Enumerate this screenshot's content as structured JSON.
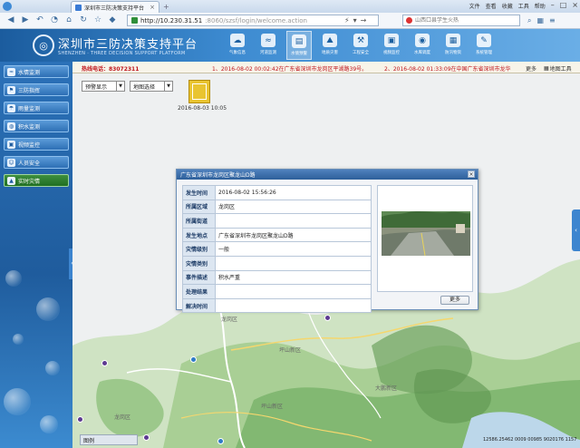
{
  "browser": {
    "tab_title": "深圳市三防决策支持平台",
    "url_host": "http://10.230.31.51",
    "url_path": ":8060/szsf/login/welcome.action",
    "search_placeholder": "山西口县学生火热",
    "window_menu": [
      "文件",
      "查看",
      "收藏",
      "工具",
      "帮助"
    ]
  },
  "app": {
    "title": "深圳市三防决策支持平台",
    "subtitle": "SHENZHEN · THREE DECISION SUPPORT PLATFORM",
    "modules": [
      {
        "label": "气象信息",
        "icon": "cloud-icon"
      },
      {
        "label": "河道监测",
        "icon": "water-icon"
      },
      {
        "label": "水情预警",
        "icon": "warning-icon",
        "active": true
      },
      {
        "label": "地质灾害",
        "icon": "mountain-icon"
      },
      {
        "label": "工程安全",
        "icon": "dam-icon"
      },
      {
        "label": "视频监控",
        "icon": "video-icon"
      },
      {
        "label": "水库调度",
        "icon": "reservoir-icon"
      },
      {
        "label": "防汛物资",
        "icon": "box-icon"
      },
      {
        "label": "系统管理",
        "icon": "tools-icon"
      }
    ]
  },
  "info": {
    "hotline": "热线电话：83072311",
    "ticker1": "1、2016-08-02 00:02:42在广东省深圳市龙岗区平湖路39号。",
    "ticker2": "2、2016-08-02 01:33:09在中国广东省深圳市龙华",
    "more": "更多",
    "full_map": "地图工具"
  },
  "sidebar": {
    "items": [
      {
        "label": "水情监测",
        "icon": "wave-icon"
      },
      {
        "label": "三防指挥",
        "icon": "command-icon"
      },
      {
        "label": "雨量监测",
        "icon": "rain-icon"
      },
      {
        "label": "积水监测",
        "icon": "flood-icon"
      },
      {
        "label": "视频监控",
        "icon": "camera-icon"
      },
      {
        "label": "人员安全",
        "icon": "people-icon"
      },
      {
        "label": "实时灾情",
        "icon": "alert-icon",
        "active": true
      }
    ]
  },
  "map": {
    "select_level": "预警显示",
    "select_area": "地图选择",
    "thumb_date": "2016-08-03 10:05",
    "places": [
      {
        "name": "龙岗区"
      },
      {
        "name": "坪山新区"
      },
      {
        "name": "坪山新区"
      },
      {
        "name": "龙岗区"
      },
      {
        "name": "大鹏新区"
      }
    ],
    "legend": "图例",
    "coord_readout": "12586.25462 0009 00985 9020176 1157"
  },
  "dialog": {
    "title": "广东省深圳市龙岗区聚龙山D路",
    "rows": [
      {
        "key": "发生时间",
        "value": "2016-08-02 15:56:26"
      },
      {
        "key": "所属区域",
        "value": "龙岗区"
      },
      {
        "key": "所属街道",
        "value": ""
      },
      {
        "key": "发生地点",
        "value": "广东省深圳市龙岗区聚龙山D路"
      },
      {
        "key": "灾情级别",
        "value": "一般"
      },
      {
        "key": "灾情类别",
        "value": ""
      },
      {
        "key": "事件描述",
        "value": "积水严重"
      },
      {
        "key": "处理结果",
        "value": ""
      },
      {
        "key": "解决时间",
        "value": ""
      }
    ],
    "more_button": "更多"
  },
  "colors": {
    "header_blue": "#2a72bb",
    "ticker_red": "#c0161d",
    "sidebar_active_green": "#1f6e22",
    "marker_purple": "#5d3a91"
  }
}
